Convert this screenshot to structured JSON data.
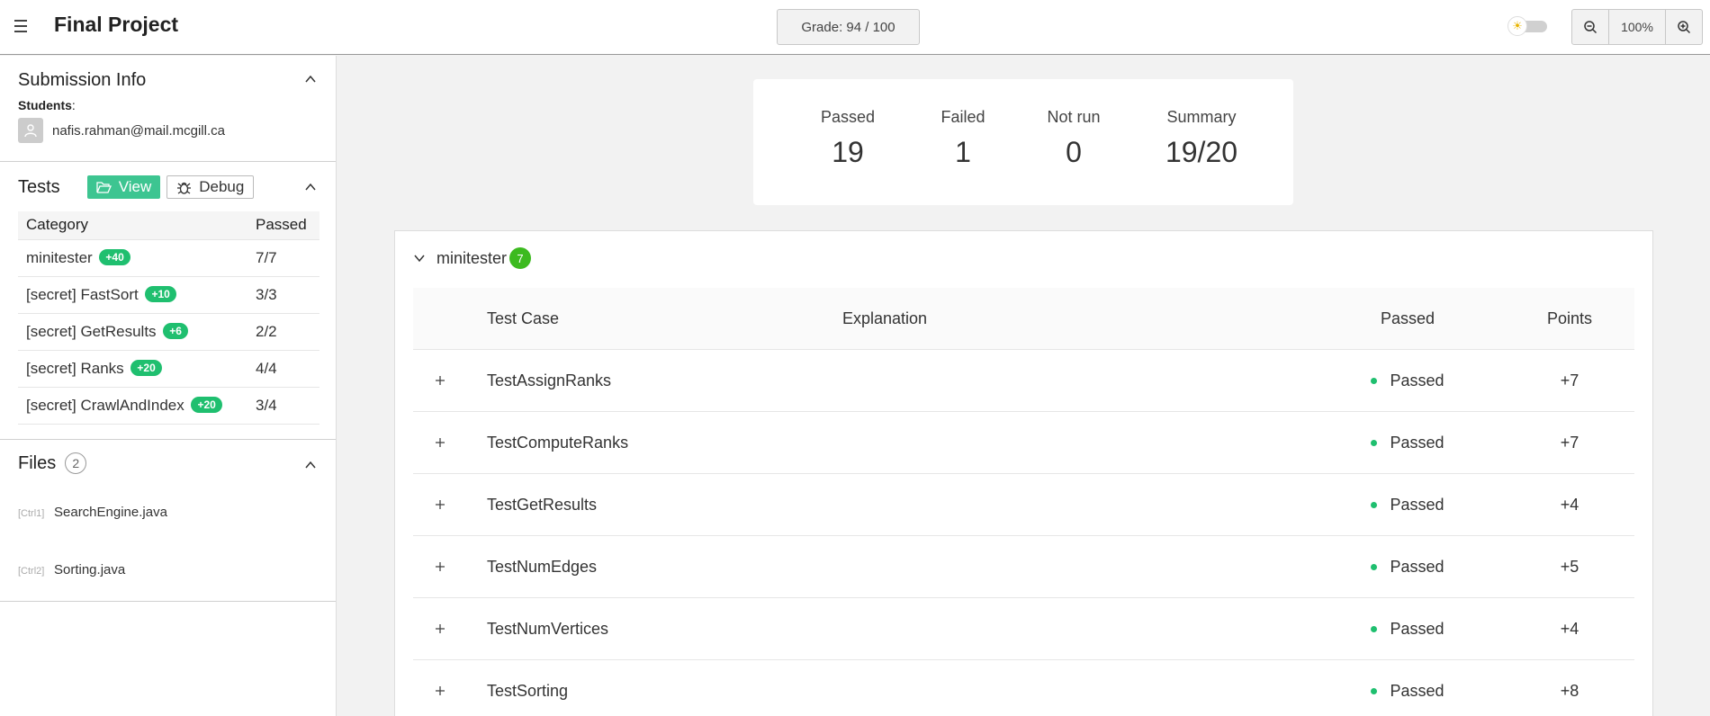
{
  "header": {
    "title": "Final Project",
    "grade": "Grade: 94 / 100",
    "zoom": "100%"
  },
  "submission": {
    "title": "Submission Info",
    "students_label": "Students",
    "student_email": "nafis.rahman@mail.mcgill.ca"
  },
  "tests": {
    "title": "Tests",
    "view_label": "View",
    "debug_label": "Debug",
    "columns": [
      "Category",
      "Passed"
    ],
    "rows": [
      {
        "name": "minitester",
        "badge": "+40",
        "passed": "7/7"
      },
      {
        "name": "[secret] FastSort",
        "badge": "+10",
        "passed": "3/3"
      },
      {
        "name": "[secret] GetResults",
        "badge": "+6",
        "passed": "2/2"
      },
      {
        "name": "[secret] Ranks",
        "badge": "+20",
        "passed": "4/4"
      },
      {
        "name": "[secret] CrawlAndIndex",
        "badge": "+20",
        "passed": "3/4"
      }
    ]
  },
  "files": {
    "title": "Files",
    "count": "2",
    "items": [
      {
        "key": "[Ctrl1]",
        "name": "SearchEngine.java"
      },
      {
        "key": "[Ctrl2]",
        "name": "Sorting.java"
      }
    ]
  },
  "summary": {
    "passed_label": "Passed",
    "passed": "19",
    "failed_label": "Failed",
    "failed": "1",
    "notrun_label": "Not run",
    "notrun": "0",
    "summary_label": "Summary",
    "summary": "19/20"
  },
  "group": {
    "name": "minitester",
    "count": "7",
    "columns": {
      "test_case": "Test Case",
      "explanation": "Explanation",
      "passed": "Passed",
      "points": "Points"
    },
    "rows": [
      {
        "name": "TestAssignRanks",
        "status": "Passed",
        "points": "+7"
      },
      {
        "name": "TestComputeRanks",
        "status": "Passed",
        "points": "+7"
      },
      {
        "name": "TestGetResults",
        "status": "Passed",
        "points": "+4"
      },
      {
        "name": "TestNumEdges",
        "status": "Passed",
        "points": "+5"
      },
      {
        "name": "TestNumVertices",
        "status": "Passed",
        "points": "+4"
      },
      {
        "name": "TestSorting",
        "status": "Passed",
        "points": "+8"
      }
    ]
  },
  "colors": {
    "accent_green": "#3dc591",
    "badge_green": "#1fbf6f",
    "count_green": "#3cba1f"
  }
}
